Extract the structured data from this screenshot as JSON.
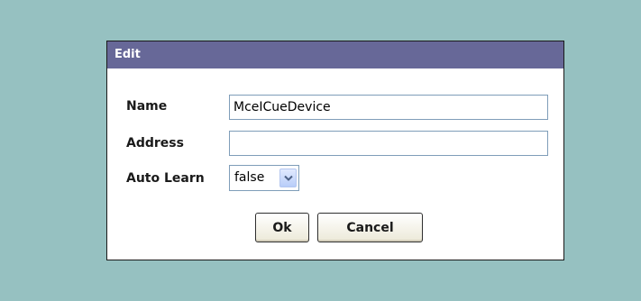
{
  "dialog": {
    "title": "Edit",
    "fields": {
      "name": {
        "label": "Name",
        "value": "MceICueDevice"
      },
      "address": {
        "label": "Address",
        "value": ""
      },
      "auto_learn": {
        "label": "Auto Learn",
        "value": "false"
      }
    },
    "buttons": {
      "ok": "Ok",
      "cancel": "Cancel"
    }
  },
  "colors": {
    "background": "#96c1c1",
    "titlebar": "#676898"
  },
  "icons": {
    "dropdown": "chevron-down-icon"
  }
}
